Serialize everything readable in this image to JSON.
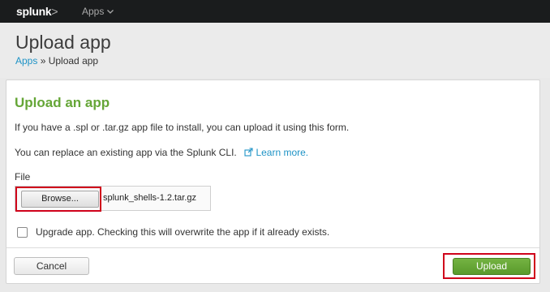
{
  "topbar": {
    "logo_text": "splunk",
    "logo_suffix": ">",
    "apps_label": "Apps",
    "apps_icon": "chevron-down-icon"
  },
  "header": {
    "title": "Upload app",
    "breadcrumb_link": "Apps",
    "breadcrumb_sep": " » ",
    "breadcrumb_current": "Upload app"
  },
  "panel": {
    "title": "Upload an app",
    "intro": "If you have a .spl or .tar.gz app file to install, you can upload it using this form.",
    "cli_text": "You can replace an existing app via the Splunk CLI.",
    "learn_more": "Learn more.",
    "learn_more_icon": "external-link-icon",
    "file_label": "File",
    "browse_label": "Browse...",
    "file_name": "splunk_shells-1.2.tar.gz",
    "upgrade_label": "Upgrade app. Checking this will overwrite the app if it already exists.",
    "upgrade_checked": false
  },
  "footer": {
    "cancel_label": "Cancel",
    "upload_label": "Upload"
  },
  "colors": {
    "accent_green": "#65a637",
    "link_blue": "#1e93c6",
    "highlight_red": "#d0021b",
    "topbar_bg": "#1a1c1d"
  }
}
